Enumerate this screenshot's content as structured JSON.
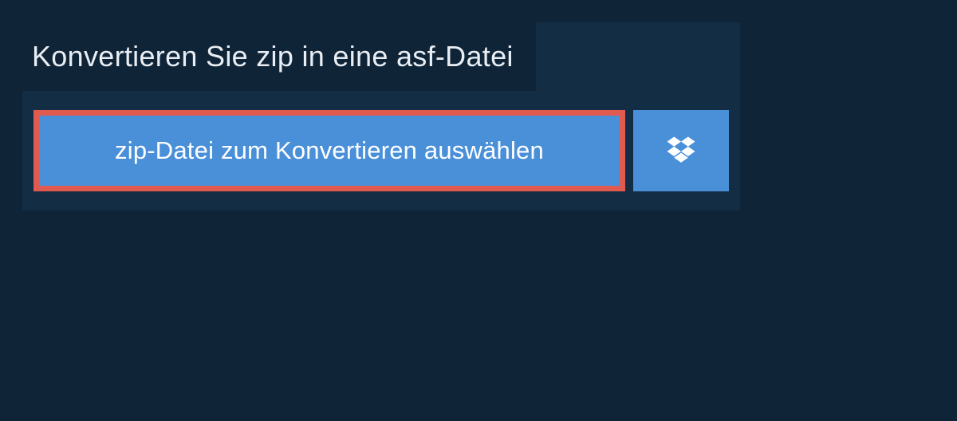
{
  "heading": "Konvertieren Sie zip in eine asf-Datei",
  "select_button_label": "zip-Datei zum Konvertieren auswählen",
  "dropbox_icon_name": "dropbox-icon",
  "colors": {
    "page_bg": "#0f2437",
    "panel_bg": "#132d44",
    "button_bg": "#4a90d9",
    "button_border_highlight": "#e05a50",
    "text_light": "#e8eef4"
  }
}
